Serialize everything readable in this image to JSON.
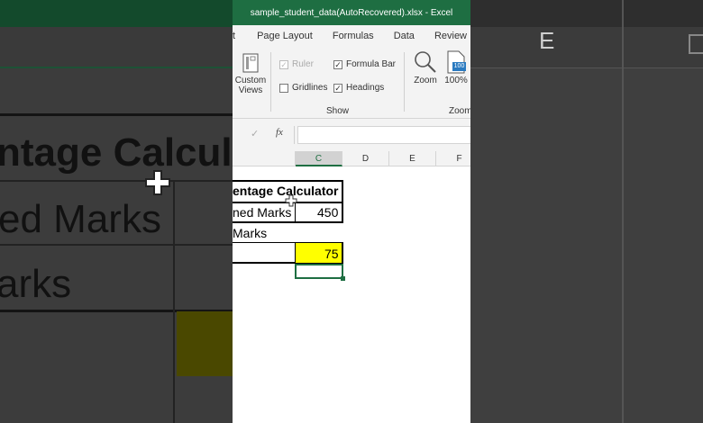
{
  "app": {
    "window_title": "sample_student_data(AutoRecovered).xlsx  -  Excel",
    "tabs": [
      "t",
      "Page Layout",
      "Formulas",
      "Data",
      "Review"
    ],
    "ribbon": {
      "custom_views_line1": "Custom",
      "custom_views_line2": "Views",
      "ruler_label": "Ruler",
      "gridlines_label": "Gridlines",
      "formula_bar_label": "Formula Bar",
      "headings_label": "Headings",
      "show_group_label": "Show",
      "zoom_label": "Zoom",
      "zoom100_label": "100%",
      "zoom_group_label": "Zoom",
      "zoom_icon_badge": "100",
      "check_mark": "✓"
    },
    "formula_bar": {
      "fx_label": "fx",
      "check": "✓"
    },
    "columns": [
      "C",
      "D",
      "E",
      "F"
    ],
    "sheet": {
      "title": "entage Calculator",
      "row1_label": "ned Marks",
      "row1_value": "450",
      "row2_label": "Marks",
      "row3_value": "75"
    },
    "colors": {
      "excel_green": "#1e6e42",
      "highlight_yellow": "#ffff00"
    }
  },
  "background": {
    "left_zoom_texts": [
      "ntage Calcul",
      "ed Marks",
      "arks"
    ],
    "right_column_letters": [
      "E"
    ]
  }
}
